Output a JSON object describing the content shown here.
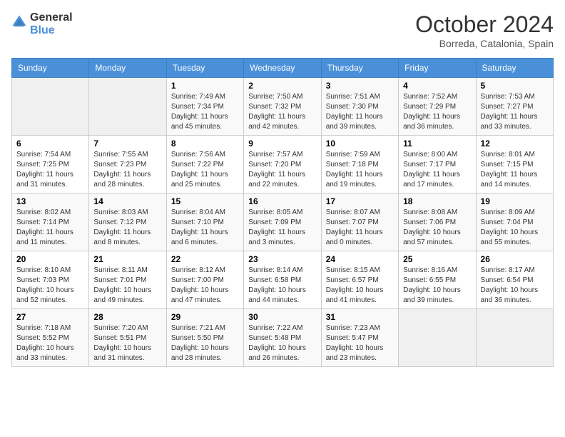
{
  "header": {
    "logo_general": "General",
    "logo_blue": "Blue",
    "month": "October 2024",
    "location": "Borreda, Catalonia, Spain"
  },
  "days_of_week": [
    "Sunday",
    "Monday",
    "Tuesday",
    "Wednesday",
    "Thursday",
    "Friday",
    "Saturday"
  ],
  "weeks": [
    [
      {
        "day": "",
        "sunrise": "",
        "sunset": "",
        "daylight": ""
      },
      {
        "day": "",
        "sunrise": "",
        "sunset": "",
        "daylight": ""
      },
      {
        "day": "1",
        "sunrise": "Sunrise: 7:49 AM",
        "sunset": "Sunset: 7:34 PM",
        "daylight": "Daylight: 11 hours and 45 minutes."
      },
      {
        "day": "2",
        "sunrise": "Sunrise: 7:50 AM",
        "sunset": "Sunset: 7:32 PM",
        "daylight": "Daylight: 11 hours and 42 minutes."
      },
      {
        "day": "3",
        "sunrise": "Sunrise: 7:51 AM",
        "sunset": "Sunset: 7:30 PM",
        "daylight": "Daylight: 11 hours and 39 minutes."
      },
      {
        "day": "4",
        "sunrise": "Sunrise: 7:52 AM",
        "sunset": "Sunset: 7:29 PM",
        "daylight": "Daylight: 11 hours and 36 minutes."
      },
      {
        "day": "5",
        "sunrise": "Sunrise: 7:53 AM",
        "sunset": "Sunset: 7:27 PM",
        "daylight": "Daylight: 11 hours and 33 minutes."
      }
    ],
    [
      {
        "day": "6",
        "sunrise": "Sunrise: 7:54 AM",
        "sunset": "Sunset: 7:25 PM",
        "daylight": "Daylight: 11 hours and 31 minutes."
      },
      {
        "day": "7",
        "sunrise": "Sunrise: 7:55 AM",
        "sunset": "Sunset: 7:23 PM",
        "daylight": "Daylight: 11 hours and 28 minutes."
      },
      {
        "day": "8",
        "sunrise": "Sunrise: 7:56 AM",
        "sunset": "Sunset: 7:22 PM",
        "daylight": "Daylight: 11 hours and 25 minutes."
      },
      {
        "day": "9",
        "sunrise": "Sunrise: 7:57 AM",
        "sunset": "Sunset: 7:20 PM",
        "daylight": "Daylight: 11 hours and 22 minutes."
      },
      {
        "day": "10",
        "sunrise": "Sunrise: 7:59 AM",
        "sunset": "Sunset: 7:18 PM",
        "daylight": "Daylight: 11 hours and 19 minutes."
      },
      {
        "day": "11",
        "sunrise": "Sunrise: 8:00 AM",
        "sunset": "Sunset: 7:17 PM",
        "daylight": "Daylight: 11 hours and 17 minutes."
      },
      {
        "day": "12",
        "sunrise": "Sunrise: 8:01 AM",
        "sunset": "Sunset: 7:15 PM",
        "daylight": "Daylight: 11 hours and 14 minutes."
      }
    ],
    [
      {
        "day": "13",
        "sunrise": "Sunrise: 8:02 AM",
        "sunset": "Sunset: 7:14 PM",
        "daylight": "Daylight: 11 hours and 11 minutes."
      },
      {
        "day": "14",
        "sunrise": "Sunrise: 8:03 AM",
        "sunset": "Sunset: 7:12 PM",
        "daylight": "Daylight: 11 hours and 8 minutes."
      },
      {
        "day": "15",
        "sunrise": "Sunrise: 8:04 AM",
        "sunset": "Sunset: 7:10 PM",
        "daylight": "Daylight: 11 hours and 6 minutes."
      },
      {
        "day": "16",
        "sunrise": "Sunrise: 8:05 AM",
        "sunset": "Sunset: 7:09 PM",
        "daylight": "Daylight: 11 hours and 3 minutes."
      },
      {
        "day": "17",
        "sunrise": "Sunrise: 8:07 AM",
        "sunset": "Sunset: 7:07 PM",
        "daylight": "Daylight: 11 hours and 0 minutes."
      },
      {
        "day": "18",
        "sunrise": "Sunrise: 8:08 AM",
        "sunset": "Sunset: 7:06 PM",
        "daylight": "Daylight: 10 hours and 57 minutes."
      },
      {
        "day": "19",
        "sunrise": "Sunrise: 8:09 AM",
        "sunset": "Sunset: 7:04 PM",
        "daylight": "Daylight: 10 hours and 55 minutes."
      }
    ],
    [
      {
        "day": "20",
        "sunrise": "Sunrise: 8:10 AM",
        "sunset": "Sunset: 7:03 PM",
        "daylight": "Daylight: 10 hours and 52 minutes."
      },
      {
        "day": "21",
        "sunrise": "Sunrise: 8:11 AM",
        "sunset": "Sunset: 7:01 PM",
        "daylight": "Daylight: 10 hours and 49 minutes."
      },
      {
        "day": "22",
        "sunrise": "Sunrise: 8:12 AM",
        "sunset": "Sunset: 7:00 PM",
        "daylight": "Daylight: 10 hours and 47 minutes."
      },
      {
        "day": "23",
        "sunrise": "Sunrise: 8:14 AM",
        "sunset": "Sunset: 6:58 PM",
        "daylight": "Daylight: 10 hours and 44 minutes."
      },
      {
        "day": "24",
        "sunrise": "Sunrise: 8:15 AM",
        "sunset": "Sunset: 6:57 PM",
        "daylight": "Daylight: 10 hours and 41 minutes."
      },
      {
        "day": "25",
        "sunrise": "Sunrise: 8:16 AM",
        "sunset": "Sunset: 6:55 PM",
        "daylight": "Daylight: 10 hours and 39 minutes."
      },
      {
        "day": "26",
        "sunrise": "Sunrise: 8:17 AM",
        "sunset": "Sunset: 6:54 PM",
        "daylight": "Daylight: 10 hours and 36 minutes."
      }
    ],
    [
      {
        "day": "27",
        "sunrise": "Sunrise: 7:18 AM",
        "sunset": "Sunset: 5:52 PM",
        "daylight": "Daylight: 10 hours and 33 minutes."
      },
      {
        "day": "28",
        "sunrise": "Sunrise: 7:20 AM",
        "sunset": "Sunset: 5:51 PM",
        "daylight": "Daylight: 10 hours and 31 minutes."
      },
      {
        "day": "29",
        "sunrise": "Sunrise: 7:21 AM",
        "sunset": "Sunset: 5:50 PM",
        "daylight": "Daylight: 10 hours and 28 minutes."
      },
      {
        "day": "30",
        "sunrise": "Sunrise: 7:22 AM",
        "sunset": "Sunset: 5:48 PM",
        "daylight": "Daylight: 10 hours and 26 minutes."
      },
      {
        "day": "31",
        "sunrise": "Sunrise: 7:23 AM",
        "sunset": "Sunset: 5:47 PM",
        "daylight": "Daylight: 10 hours and 23 minutes."
      },
      {
        "day": "",
        "sunrise": "",
        "sunset": "",
        "daylight": ""
      },
      {
        "day": "",
        "sunrise": "",
        "sunset": "",
        "daylight": ""
      }
    ]
  ]
}
